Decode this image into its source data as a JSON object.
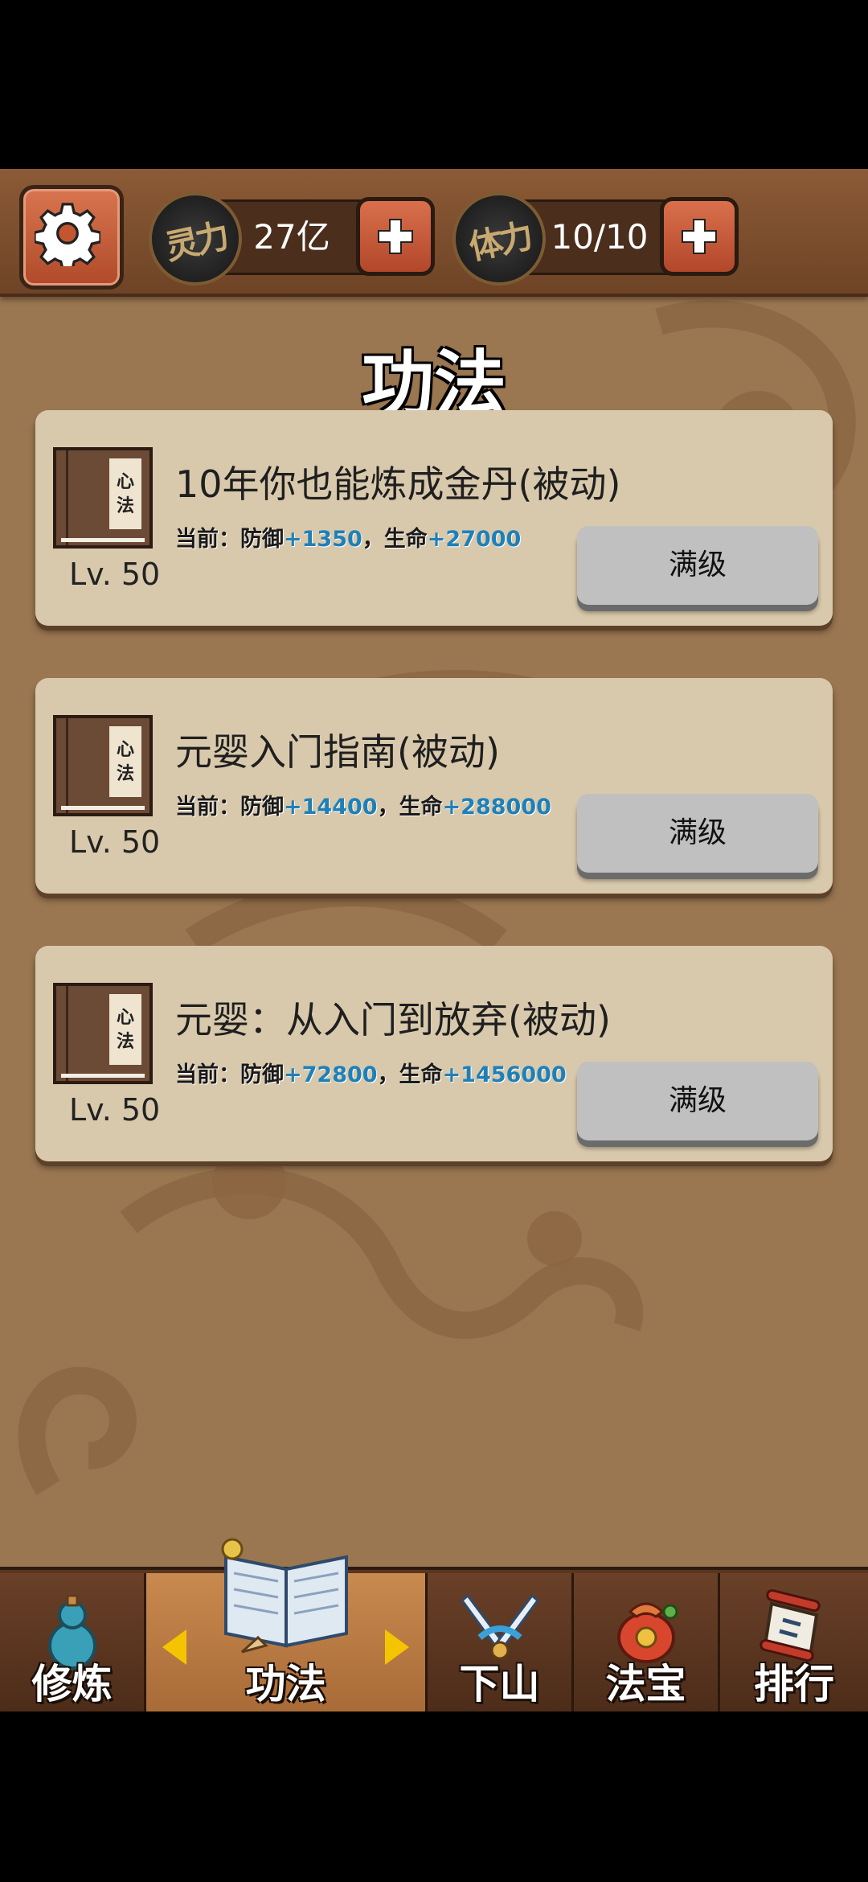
{
  "topbar": {
    "spirit": {
      "badge": "灵力",
      "value": "27亿"
    },
    "stamina": {
      "badge": "体力",
      "value": "10/10"
    }
  },
  "page_title": "功法",
  "skills": [
    {
      "book_label": [
        "心",
        "法"
      ],
      "name": "10年你也能炼成金丹(被动)",
      "level": "Lv. 50",
      "stats_prefix": "当前：防御",
      "defense": "+1350",
      "sep": "，生命",
      "life": "+27000",
      "button": "满级"
    },
    {
      "book_label": [
        "心",
        "法"
      ],
      "name": "元婴入门指南(被动)",
      "level": "Lv. 50",
      "stats_prefix": "当前：防御",
      "defense": "+14400",
      "sep": "，生命",
      "life": "+288000",
      "button": "满级"
    },
    {
      "book_label": [
        "心",
        "法"
      ],
      "name": "元婴：从入门到放弃(被动)",
      "level": "Lv. 50",
      "stats_prefix": "当前：防御",
      "defense": "+72800",
      "sep": "，生命",
      "life": "+1456000",
      "button": "满级"
    }
  ],
  "nav": {
    "items": [
      {
        "label": "修炼",
        "icon": "gourd-icon"
      },
      {
        "label": "功法",
        "icon": "open-book-icon",
        "active": true
      },
      {
        "label": "下山",
        "icon": "crossed-swords-icon"
      },
      {
        "label": "法宝",
        "icon": "treasure-bag-icon"
      },
      {
        "label": "排行",
        "icon": "scroll-icon"
      }
    ]
  },
  "colors": {
    "accent_button": "#c4562f",
    "stat_value": "#1f80b8",
    "nav_active": "#b97a42"
  }
}
